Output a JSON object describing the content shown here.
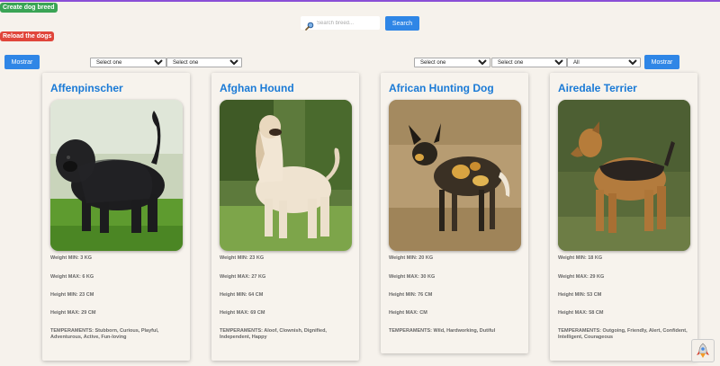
{
  "toolbar": {
    "create_label": "Create dog breed",
    "reload_label": "Reload the dogs",
    "search_placeholder": "Search breed...",
    "search_label": "Search",
    "mostrar_label": "Mostrar"
  },
  "filters": {
    "left": [
      "Select one",
      "Select one"
    ],
    "right": [
      "Select one",
      "Select one",
      "All"
    ]
  },
  "dogs": [
    {
      "name": "Affenpinscher",
      "weight_min": "Weight MIN: 3 KG",
      "weight_max": "Weight MAX: 6 KG",
      "height_min": "Height MIN: 23 CM",
      "height_max": "Height MAX: 29 CM",
      "temperaments": "TEMPERAMENTS: Stubborn, Curious, Playful, Adventurous, Active, Fun-loving"
    },
    {
      "name": "Afghan Hound",
      "weight_min": "Weight MIN: 23 KG",
      "weight_max": "Weight MAX: 27 KG",
      "height_min": "Height MIN: 64 CM",
      "height_max": "Height MAX: 69 CM",
      "temperaments": "TEMPERAMENTS: Aloof, Clownish, Dignified, Independent, Happy"
    },
    {
      "name": "African Hunting Dog",
      "weight_min": "Weight MIN: 20 KG",
      "weight_max": "Weight MAX: 30 KG",
      "height_min": "Height MIN: 76 CM",
      "height_max": "Height MAX: CM",
      "temperaments": "TEMPERAMENTS: Wild, Hardworking, Dutiful"
    },
    {
      "name": "Airedale Terrier",
      "weight_min": "Weight MIN: 18 KG",
      "weight_max": "Weight MAX: 29 KG",
      "height_min": "Height MIN: 53 CM",
      "height_max": "Height MAX: 58 CM",
      "temperaments": "TEMPERAMENTS: Outgoing, Friendly, Alert, Confident, Intelligent, Courageous"
    }
  ],
  "icons": {
    "search": "search-icon",
    "rocket": "rocket-icon"
  },
  "colors": {
    "create_button": "#3aa455",
    "reload_button": "#e0463b",
    "primary_button": "#2f86e6",
    "card_title": "#1a7ad6"
  }
}
